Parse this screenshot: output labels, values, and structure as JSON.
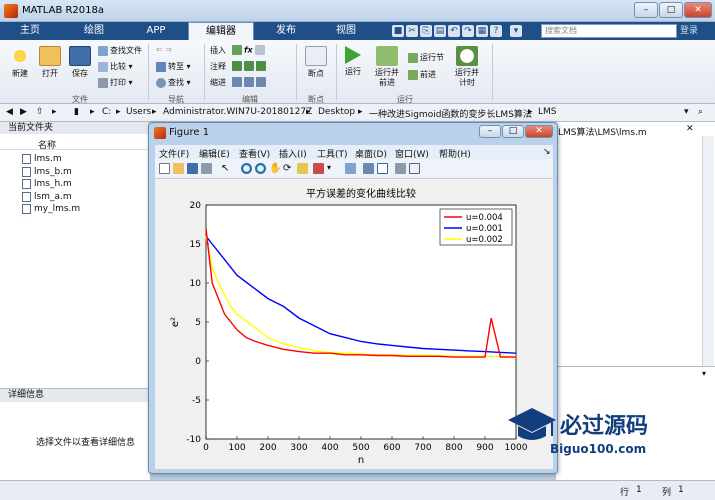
{
  "window": {
    "title": "MATLAB R2018a",
    "minimize": "–",
    "maximize": "□",
    "close": "✕"
  },
  "ribbon_tabs": [
    "主页",
    "绘图",
    "APP",
    "编辑器",
    "发布",
    "视图"
  ],
  "search": {
    "placeholder": "搜索文档",
    "login": "登录"
  },
  "ribbon": {
    "file": {
      "new": "新建",
      "open": "打开",
      "save": "保存",
      "find_files": "查找文件",
      "compare": "比较",
      "print": "打印",
      "section": "文件"
    },
    "nav": {
      "goto": "转至",
      "find": "查找",
      "section": "导航"
    },
    "edit": {
      "insert": "插入",
      "comment": "注释",
      "indent": "缩进",
      "fx": "fx",
      "section": "编辑"
    },
    "breakpoint": {
      "label": "断点",
      "section": "断点"
    },
    "run": {
      "run": "运行",
      "run_advance": "运行并前进",
      "run_section": "运行节",
      "advance": "前进",
      "run_time": "运行并计时",
      "section": "运行"
    }
  },
  "address": {
    "path": [
      "C:",
      "Users",
      "Administrator.WIN7U-20180127Z",
      "Desktop",
      "一种改进Sigmoid函数的变步长LMS算法",
      "LMS"
    ]
  },
  "current_folder": {
    "header": "当前文件夹",
    "column": "名称",
    "files": [
      "lms.m",
      "lms_b.m",
      "lms_h.m",
      "lsm_a.m",
      "my_lms.m"
    ]
  },
  "details": {
    "header": "详细信息",
    "hint": "选择文件以查看详细信息"
  },
  "editor_tab": "LMS算法\\LMS\\lms.m",
  "status": {
    "row_label": "行",
    "row": "1",
    "col_label": "列",
    "col": "1"
  },
  "figure": {
    "title": "Figure 1",
    "menu": [
      "文件(F)",
      "编辑(E)",
      "查看(V)",
      "插入(I)",
      "工具(T)",
      "桌面(D)",
      "窗口(W)",
      "帮助(H)"
    ]
  },
  "chart_data": {
    "type": "line",
    "title": "平方误差的变化曲线比较",
    "xlabel": "n",
    "ylabel": "e²",
    "xlim": [
      0,
      1000
    ],
    "ylim": [
      -10,
      20
    ],
    "xticks": [
      0,
      100,
      200,
      300,
      400,
      500,
      600,
      700,
      800,
      900,
      1000
    ],
    "yticks": [
      -10,
      -5,
      0,
      5,
      10,
      15,
      20
    ],
    "legend_position": "top-right",
    "series": [
      {
        "name": "u=0.004",
        "color": "#ff0000",
        "x": [
          0,
          20,
          40,
          60,
          80,
          100,
          130,
          160,
          200,
          250,
          300,
          350,
          400,
          450,
          500,
          550,
          600,
          650,
          700,
          750,
          800,
          850,
          900,
          920,
          950,
          1000
        ],
        "values": [
          17,
          10,
          8,
          6,
          5,
          4,
          3,
          2.5,
          2,
          1.5,
          1.2,
          1,
          1,
          0.8,
          0.8,
          0.7,
          0.7,
          0.6,
          0.6,
          0.6,
          0.5,
          0.5,
          0.5,
          5.5,
          0.5,
          0.5
        ]
      },
      {
        "name": "u=0.001",
        "color": "#0000ff",
        "x": [
          0,
          20,
          40,
          60,
          80,
          100,
          150,
          200,
          250,
          300,
          350,
          400,
          450,
          500,
          550,
          600,
          650,
          700,
          750,
          800,
          850,
          900,
          950,
          1000
        ],
        "values": [
          16,
          15,
          14,
          13,
          12,
          11,
          9.5,
          8,
          7,
          5.5,
          4.5,
          3.5,
          3,
          2.5,
          2.2,
          2,
          1.8,
          1.6,
          1.5,
          1.4,
          1.3,
          1.2,
          1.1,
          1
        ]
      },
      {
        "name": "u=0.002",
        "color": "#ffff00",
        "x": [
          0,
          20,
          40,
          60,
          80,
          100,
          150,
          200,
          250,
          300,
          350,
          400,
          450,
          500,
          550,
          600,
          650,
          700,
          750,
          800,
          850,
          900,
          950,
          1000
        ],
        "values": [
          16,
          12,
          10,
          8.5,
          7,
          6,
          4.5,
          3,
          2.2,
          1.7,
          1.3,
          1.1,
          1,
          0.9,
          0.8,
          0.8,
          0.7,
          0.7,
          0.7,
          0.6,
          0.6,
          0.6,
          0.6,
          0.6
        ]
      }
    ]
  },
  "watermark": {
    "text": "必过源码",
    "url": "Biguo100.com"
  }
}
